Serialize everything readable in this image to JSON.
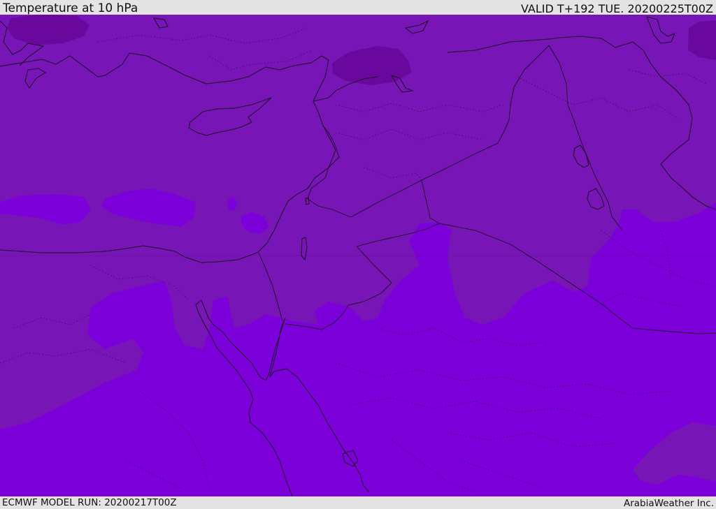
{
  "header": {
    "title": "Temperature at 10 hPa",
    "valid": "VALID T+192 TUE. 20200225T00Z"
  },
  "footer": {
    "model_run": "ECMWF MODEL RUN: 20200217T00Z",
    "credit": "ArabiaWeather Inc."
  },
  "map": {
    "colors": {
      "warm_band": "#7715b6",
      "cold_core": "#6a089d",
      "lighter_band": "#7c00da",
      "coast": "#1a1020"
    }
  }
}
